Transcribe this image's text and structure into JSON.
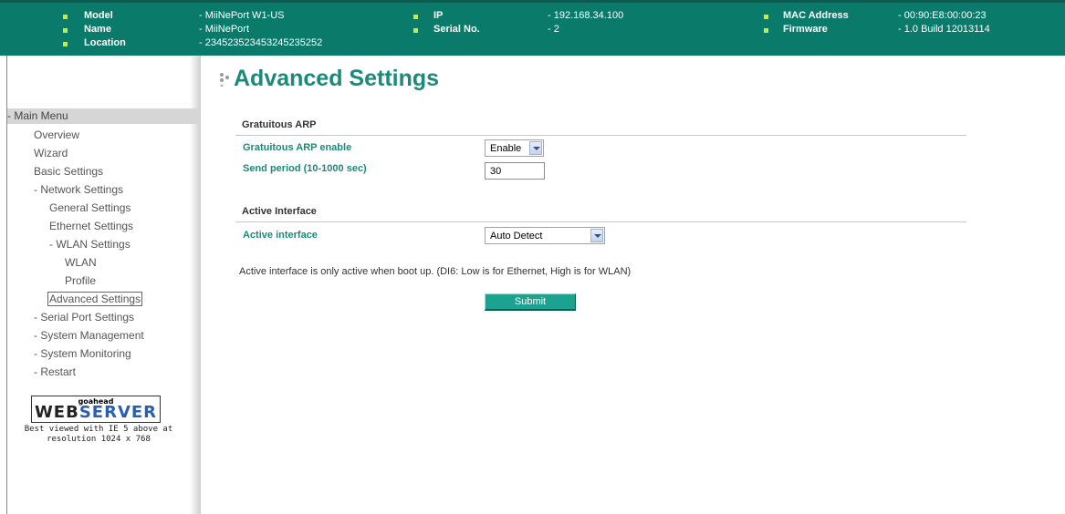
{
  "header": {
    "col1": [
      {
        "label": "Model",
        "value": "- MiiNePort W1-US"
      },
      {
        "label": "Name",
        "value": "- MiiNePort"
      },
      {
        "label": "Location",
        "value": "- 2345235234532452352​52"
      }
    ],
    "col2": [
      {
        "label": "IP",
        "value": "- 192.168.34.100"
      },
      {
        "label": "Serial No.",
        "value": "- 2"
      }
    ],
    "col3": [
      {
        "label": "MAC Address",
        "value": "- 00:90:E8:00:00:23"
      },
      {
        "label": "Firmware",
        "value": "- 1.0 Build 12013114"
      }
    ]
  },
  "sidebar": {
    "menu_header": "- Main Menu",
    "items": [
      {
        "label": "Overview"
      },
      {
        "label": "Wizard"
      },
      {
        "label": "Basic Settings"
      },
      {
        "label": "- Network Settings"
      },
      {
        "label": "General Settings"
      },
      {
        "label": "Ethernet Settings"
      },
      {
        "label": "- WLAN Settings"
      },
      {
        "label": "WLAN"
      },
      {
        "label": "Profile"
      },
      {
        "label": "Advanced Settings"
      },
      {
        "label": "- Serial Port Settings"
      },
      {
        "label": "- System Management"
      },
      {
        "label": "- System Monitoring"
      },
      {
        "label": "- Restart"
      }
    ],
    "logo_small": "goahead",
    "logo_word1": "WEB",
    "logo_word2": "SERVER",
    "caption_line1": "Best viewed with IE 5 above at",
    "caption_line2": "resolution 1024 x 768"
  },
  "main": {
    "title": "Advanced Settings",
    "section1": {
      "title": "Gratuitous ARP",
      "enable_label": "Gratuitous ARP enable",
      "enable_value": "Enable",
      "period_label": "Send period (10-1000 sec)",
      "period_value": "30"
    },
    "section2": {
      "title": "Active Interface",
      "interface_label": "Active interface",
      "interface_value": "Auto Detect"
    },
    "note": "Active interface is only active when boot up. (DI6: Low is for Ethernet, High is for WLAN)",
    "submit_label": "Submit"
  },
  "colors": {
    "header_bg": "#0a7a6a",
    "accent": "#1a8a7a",
    "bullet": "#c7e84a",
    "submit_bg": "#1ba38f"
  }
}
